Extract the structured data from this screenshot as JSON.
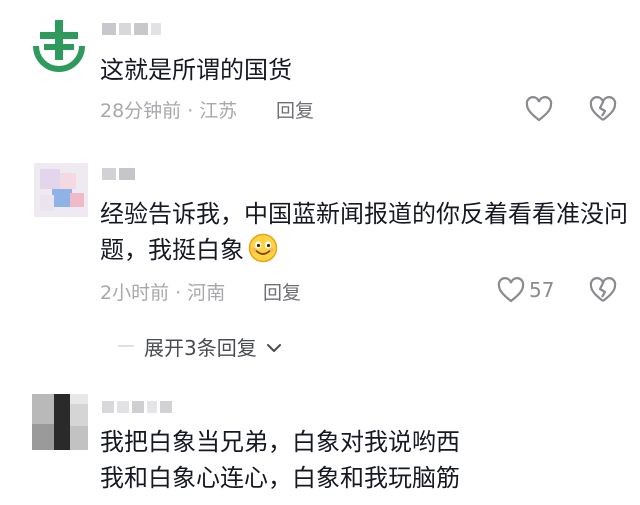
{
  "comments": [
    {
      "text": "这就是所谓的国货",
      "meta": "28分钟前 · 江苏",
      "reply_label": "回复",
      "likes": ""
    },
    {
      "text_line1": "经验告诉我，中国蓝新闻报道的你反着看看准没问",
      "text_line2": "题，我挺白象",
      "meta": "2小时前 · 河南",
      "reply_label": "回复",
      "likes": "57",
      "expand_label": "展开3条回复"
    },
    {
      "text_line1": "我把白象当兄弟，白象对我说哟西",
      "text_line2": "我和白象心连心，白象和我玩脑筋"
    }
  ],
  "icons": {
    "like": "heart-outline-icon",
    "dislike": "broken-heart-icon",
    "expand": "chevron-down-icon",
    "emoji": "smile-emoji-icon"
  },
  "colors": {
    "text": "#161823",
    "meta": "#a8a8ac",
    "reply": "#6e6f75",
    "avatar1": "#2e9a5e"
  }
}
